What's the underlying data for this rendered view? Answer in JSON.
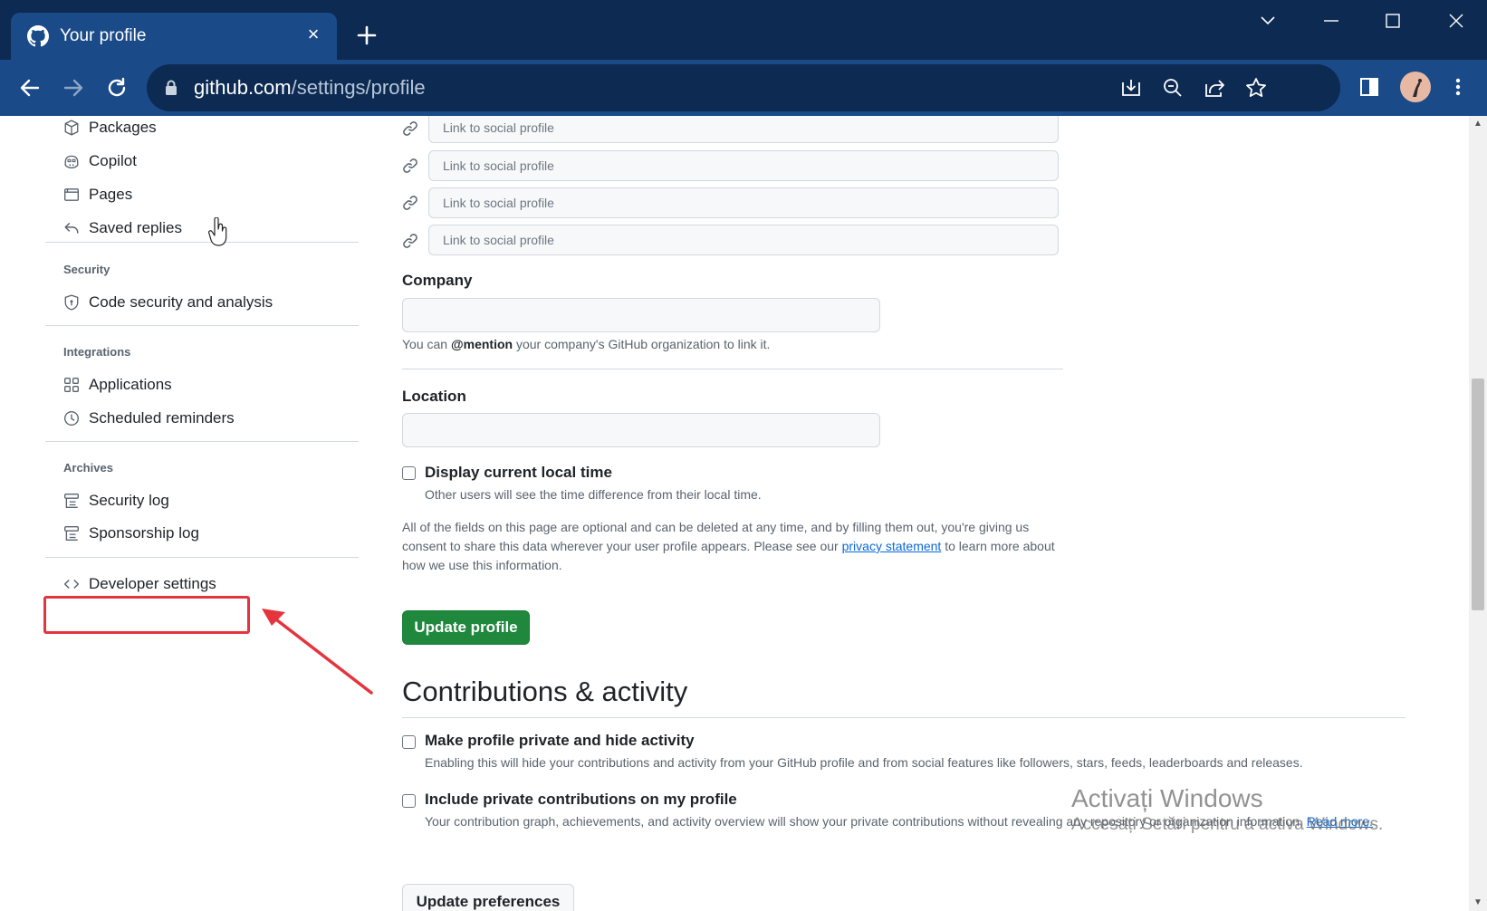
{
  "browser": {
    "tab_title": "Your profile",
    "url_host": "github.com",
    "url_path": "/settings/profile"
  },
  "sidebar": {
    "items_top": [
      {
        "label": "Packages",
        "icon": "package-icon"
      },
      {
        "label": "Copilot",
        "icon": "copilot-icon"
      },
      {
        "label": "Pages",
        "icon": "browser-icon"
      },
      {
        "label": "Saved replies",
        "icon": "reply-icon"
      }
    ],
    "security": {
      "heading": "Security",
      "items": [
        {
          "label": "Code security and analysis",
          "icon": "shield-lock-icon"
        }
      ]
    },
    "integrations": {
      "heading": "Integrations",
      "items": [
        {
          "label": "Applications",
          "icon": "apps-icon"
        },
        {
          "label": "Scheduled reminders",
          "icon": "clock-icon"
        }
      ]
    },
    "archives": {
      "heading": "Archives",
      "items": [
        {
          "label": "Security log",
          "icon": "log-icon"
        },
        {
          "label": "Sponsorship log",
          "icon": "log-icon"
        }
      ]
    },
    "developer_settings": {
      "label": "Developer settings",
      "icon": "code-icon"
    }
  },
  "profile_form": {
    "social_placeholder": "Link to social profile",
    "company": {
      "label": "Company",
      "value": "",
      "note_before": "You can ",
      "note_mention": "@mention",
      "note_after": " your company's GitHub organization to link it."
    },
    "location": {
      "label": "Location",
      "value": ""
    },
    "local_time": {
      "label": "Display current local time",
      "note": "Other users will see the time difference from their local time.",
      "checked": false
    },
    "disclaimer_before": "All of the fields on this page are optional and can be deleted at any time, and by filling them out, you're giving us consent to share this data wherever your user profile appears. Please see our ",
    "disclaimer_link": "privacy statement",
    "disclaimer_after": " to learn more about how we use this information.",
    "update_button": "Update profile"
  },
  "contributions": {
    "title": "Contributions & activity",
    "private_profile": {
      "label": "Make profile private and hide activity",
      "note": "Enabling this will hide your contributions and activity from your GitHub profile and from social features like followers, stars, feeds, leaderboards and releases.",
      "checked": false
    },
    "private_contributions": {
      "label": "Include private contributions on my profile",
      "note": "Your contribution graph, achievements, and activity overview will show your private contributions without revealing any repository or organization information.",
      "link": "Read more.",
      "checked": false
    },
    "update_button": "Update preferences"
  },
  "watermark": {
    "line1": "Activați Windows",
    "line2": "Accesați Setări pentru a activa Windows."
  },
  "colors": {
    "tab_bar": "#0c2a52",
    "toolbar": "#1a4a88",
    "primary_button": "#1f883d",
    "link": "#0969da",
    "annotation": "#e5343e"
  }
}
